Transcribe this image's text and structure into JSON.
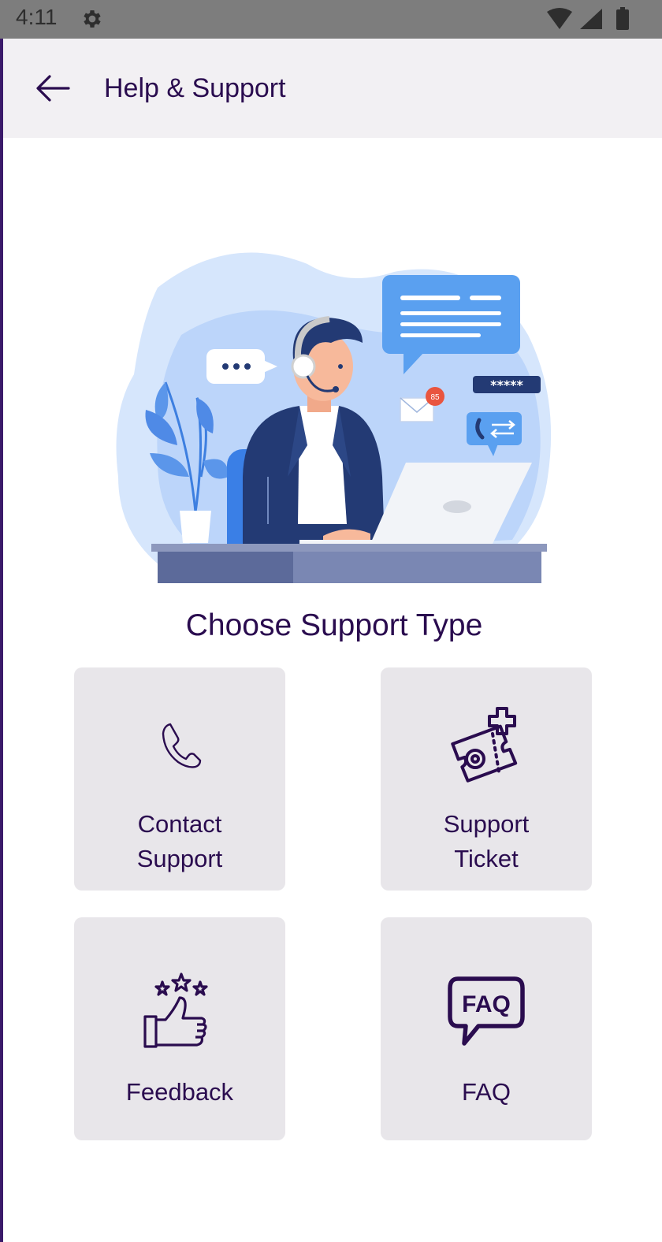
{
  "status_bar": {
    "time": "4:11",
    "icons": [
      "settings-gear-icon",
      "wifi-icon",
      "cell-signal-icon",
      "battery-icon"
    ]
  },
  "app_bar": {
    "back_icon": "arrow-left-icon",
    "title": "Help & Support"
  },
  "illustration": {
    "description_icon": "customer-support-agent-illustration",
    "notification_badge": "85",
    "password_bubble": "*****"
  },
  "section_title": "Choose Support Type",
  "cards": [
    {
      "label_line1": "Contact",
      "label_line2": "Support",
      "icon": "phone-icon"
    },
    {
      "label_line1": "Support",
      "label_line2": "Ticket",
      "icon": "ticket-plus-icon"
    },
    {
      "label": "Feedback",
      "icon": "thumbs-up-stars-icon"
    },
    {
      "label": "FAQ",
      "icon": "faq-speech-bubble-icon"
    }
  ],
  "colors": {
    "primary_text": "#2a0c4f",
    "app_bar_bg": "#f2f0f3",
    "card_bg": "#e8e6ea",
    "illustration_blue": "#c6dcfb",
    "accent_blue": "#5aa0f0",
    "navy": "#233a74"
  }
}
